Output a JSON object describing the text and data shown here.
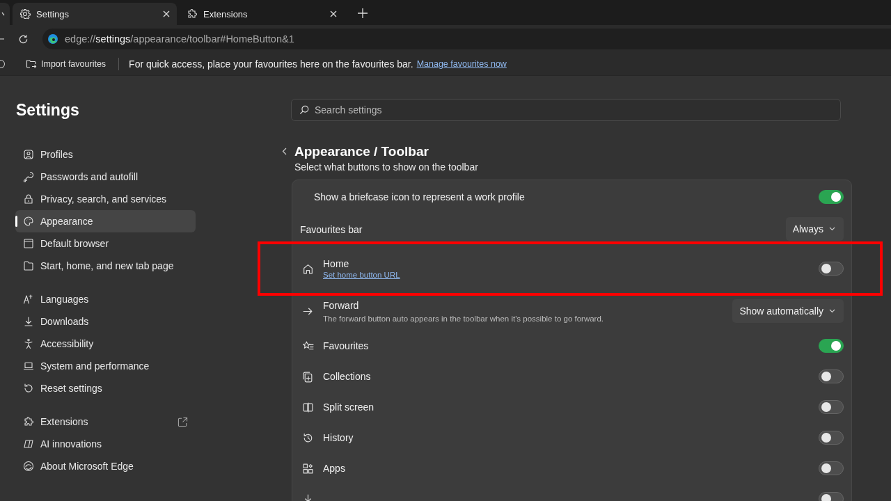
{
  "tabs": [
    {
      "label": "Settings",
      "selected": true
    },
    {
      "label": "Extensions",
      "selected": false
    }
  ],
  "address_bar": {
    "prefix": "edge://",
    "host": "settings",
    "path": "/appearance/toolbar#HomeButton&1"
  },
  "favourites_bar": {
    "import_button": "Import favourites",
    "message": "For quick access, place your favourites here on the favourites bar.",
    "link": "Manage favourites now"
  },
  "sidebar": {
    "title": "Settings",
    "groups": [
      {
        "items": [
          {
            "label": "Profiles",
            "selected": false
          },
          {
            "label": "Passwords and autofill",
            "selected": false
          },
          {
            "label": "Privacy, search, and services",
            "selected": false
          },
          {
            "label": "Appearance",
            "selected": true
          },
          {
            "label": "Default browser",
            "selected": false
          },
          {
            "label": "Start, home, and new tab page",
            "selected": false
          }
        ]
      },
      {
        "items": [
          {
            "label": "Languages",
            "selected": false
          },
          {
            "label": "Downloads",
            "selected": false
          },
          {
            "label": "Accessibility",
            "selected": false
          },
          {
            "label": "System and performance",
            "selected": false
          },
          {
            "label": "Reset settings",
            "selected": false
          }
        ]
      },
      {
        "items": [
          {
            "label": "Extensions",
            "selected": false,
            "external": true
          },
          {
            "label": "AI innovations",
            "selected": false
          },
          {
            "label": "About Microsoft Edge",
            "selected": false
          }
        ]
      }
    ]
  },
  "search": {
    "placeholder": "Search settings"
  },
  "page": {
    "title": "Appearance / Toolbar",
    "subtitle": "Select what buttons to show on the toolbar"
  },
  "rows": [
    {
      "kind": "plain_toggle",
      "label": "Show a briefcase icon to represent a work profile",
      "on": true
    },
    {
      "kind": "dropdown",
      "label": "Favourites bar",
      "value": "Always"
    },
    {
      "kind": "toggle",
      "label": "Home",
      "link": "Set home button URL",
      "on": false,
      "highlighted": true
    },
    {
      "kind": "dropdown_icon",
      "label": "Forward",
      "description": "The forward button auto appears in the toolbar when it's possible to go forward.",
      "value": "Show automatically"
    },
    {
      "kind": "toggle",
      "label": "Favourites",
      "on": true
    },
    {
      "kind": "toggle",
      "label": "Collections",
      "on": false
    },
    {
      "kind": "toggle",
      "label": "Split screen",
      "on": false
    },
    {
      "kind": "toggle",
      "label": "History",
      "on": false
    },
    {
      "kind": "toggle",
      "label": "Apps",
      "on": false
    },
    {
      "kind": "toggle",
      "on": false
    }
  ]
}
